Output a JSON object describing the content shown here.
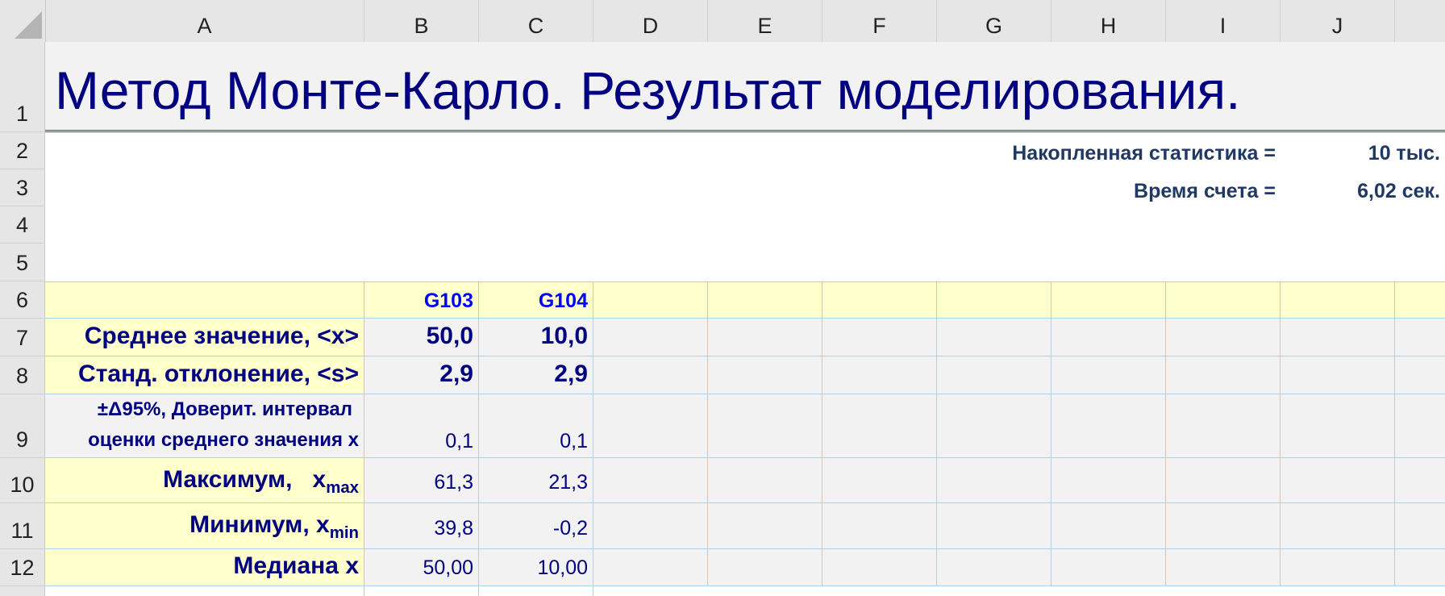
{
  "columns": [
    "A",
    "B",
    "C",
    "D",
    "E",
    "F",
    "G",
    "H",
    "I",
    "J"
  ],
  "rows": [
    "1",
    "2",
    "3",
    "4",
    "5",
    "6",
    "7",
    "8",
    "9",
    "10",
    "11",
    "12"
  ],
  "title": "Метод Монте-Карло. Результат моделирования.",
  "stats": {
    "accumulated_label": "Накопленная статистика =",
    "accumulated_value": "10 тыс.",
    "time_label": "Время счета =",
    "time_value": "6,02 сек."
  },
  "table": {
    "headers": [
      "G103",
      "G104"
    ],
    "mean": {
      "label": "Среднее значение, <x>",
      "values": [
        "50,0",
        "10,0"
      ]
    },
    "std": {
      "label": "Станд. отклонение, <s>",
      "values": [
        "2,9",
        "2,9"
      ]
    },
    "ci": {
      "label_line1": "±Δ95%, Доверит. интервал",
      "label_line2": "оценки среднего значения x",
      "values": [
        "0,1",
        "0,1"
      ]
    },
    "max": {
      "label": "Максимум,   x",
      "sub": "max",
      "values": [
        "61,3",
        "21,3"
      ]
    },
    "min": {
      "label": "Минимум, x",
      "sub": "min",
      "values": [
        "39,8",
        "-0,2"
      ]
    },
    "median": {
      "label": "Медиана x",
      "values": [
        "50,00",
        "10,00"
      ]
    }
  }
}
